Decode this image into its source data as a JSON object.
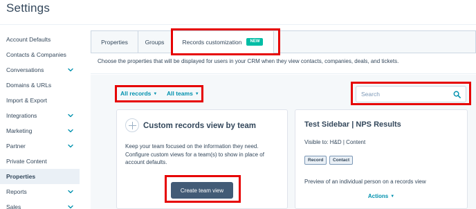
{
  "header": {
    "title": "Settings"
  },
  "sidebar": {
    "items": [
      {
        "label": "Account Defaults",
        "expandable": false,
        "active": false
      },
      {
        "label": "Contacts & Companies",
        "expandable": false,
        "active": false
      },
      {
        "label": "Conversations",
        "expandable": true,
        "active": false
      },
      {
        "label": "Domains & URLs",
        "expandable": false,
        "active": false
      },
      {
        "label": "Import & Export",
        "expandable": false,
        "active": false
      },
      {
        "label": "Integrations",
        "expandable": true,
        "active": false
      },
      {
        "label": "Marketing",
        "expandable": true,
        "active": false
      },
      {
        "label": "Partner",
        "expandable": true,
        "active": false
      },
      {
        "label": "Private Content",
        "expandable": false,
        "active": false
      },
      {
        "label": "Properties",
        "expandable": false,
        "active": true
      },
      {
        "label": "Reports",
        "expandable": true,
        "active": false
      },
      {
        "label": "Sales",
        "expandable": true,
        "active": false
      }
    ]
  },
  "tabs": [
    {
      "label": "Properties",
      "active": false
    },
    {
      "label": "Groups",
      "active": false
    },
    {
      "label": "Records customization",
      "active": true,
      "badge": "NEW"
    }
  ],
  "description": "Choose the properties that will be displayed for users in your CRM when they view contacts, companies, deals, and tickets.",
  "filters": {
    "records_label": "All records",
    "teams_label": "All teams"
  },
  "search": {
    "placeholder": "Search",
    "value": ""
  },
  "custom_view_card": {
    "title": "Custom records view by team",
    "body_lines": [
      "Keep your team focused on the information they need.",
      "Configure custom views for a team(s) to show in place of",
      "account defaults."
    ],
    "button_label": "Create team view"
  },
  "view_card": {
    "title": "Test Sidebar | NPS Results",
    "visible_to": "Visible to: H&D | Content",
    "tags": [
      "Record",
      "Contact"
    ],
    "preview_text": "Preview of an individual person on a records view",
    "actions_label": "Actions"
  },
  "colors": {
    "accent_link": "#0091ae",
    "primary_button": "#425b76",
    "new_badge": "#00bda5",
    "annotation_box": "#e60000",
    "text": "#33475b"
  },
  "icons": {
    "expand": "chevron-down-icon",
    "search": "search-icon",
    "add": "plus-icon",
    "dropdown": "caret-down-icon"
  }
}
